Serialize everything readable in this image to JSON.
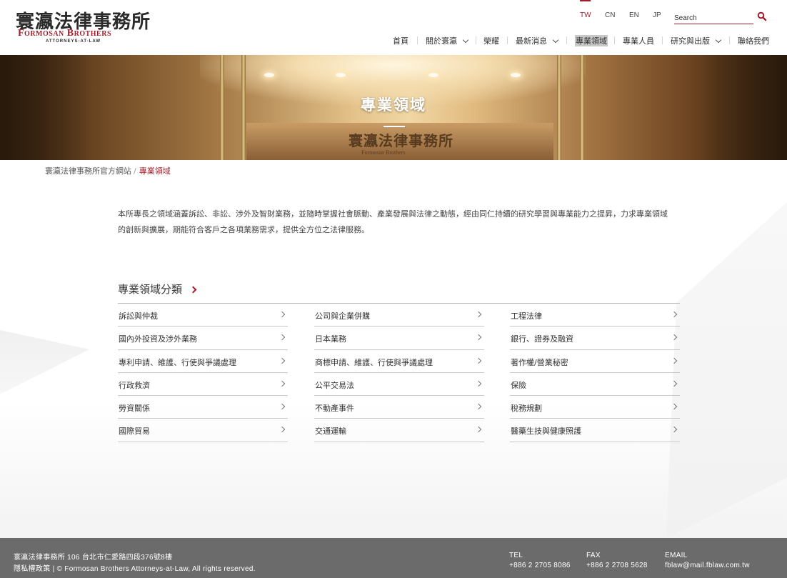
{
  "brand": {
    "name_cn": "寰瀛法律事務所",
    "name_en": "Formosan Brothers",
    "subtitle": "ATTORNEYS-AT-LAW"
  },
  "languages": [
    {
      "label": "TW",
      "active": true
    },
    {
      "label": "CN",
      "active": false
    },
    {
      "label": "EN",
      "active": false
    },
    {
      "label": "JP",
      "active": false
    }
  ],
  "search": {
    "placeholder": "Search",
    "value": ""
  },
  "nav": [
    {
      "label": "首頁",
      "dropdown": false,
      "active": false
    },
    {
      "label": "關於寰瀛",
      "dropdown": true,
      "active": false
    },
    {
      "label": "榮耀",
      "dropdown": false,
      "active": false
    },
    {
      "label": "最新消息",
      "dropdown": true,
      "active": false
    },
    {
      "label": "專業領域",
      "dropdown": false,
      "active": true
    },
    {
      "label": "專業人員",
      "dropdown": false,
      "active": false
    },
    {
      "label": "研究與出版",
      "dropdown": true,
      "active": false
    },
    {
      "label": "聯絡我們",
      "dropdown": false,
      "active": false
    }
  ],
  "banner": {
    "title": "專業領域",
    "sign_cn": "寰瀛法律事務所",
    "sign_en": "Formosan Brothers"
  },
  "breadcrumb": {
    "home": "寰瀛法律事務所官方網站",
    "separator": "/",
    "current": "專業領域"
  },
  "intro": "本所專長之領域涵蓋訴訟、非訟、涉外及智財業務，並隨時掌握社會脈動、產業發展與法律之動態，經由同仁持續的研究學習與專業能力之提昇，力求專業領域的創新與擴展，期能符合客戶之各項業務需求，提供全方位之法律服務。",
  "category": {
    "heading": "專業領域分類",
    "columns": [
      [
        "訴訟與仲裁",
        "國內外投資及涉外業務",
        "專利申請、維護、行使與爭議處理",
        "行政救濟",
        "勞資關係",
        "國際貿易"
      ],
      [
        "公司與企業併購",
        "日本業務",
        "商標申請、維護、行使與爭議處理",
        "公平交易法",
        "不動產事件",
        "交通運輸"
      ],
      [
        "工程法律",
        "銀行、證券及融資",
        "著作權/營業秘密",
        "保險",
        "稅務規劃",
        "醫藥生技與健康照護"
      ]
    ]
  },
  "footer": {
    "address": "寰瀛法律事務所 106 台北市仁愛路四段376號8樓",
    "privacy": "隱私權政策",
    "copyright": "© Formosan Brothers Attorneys-at-Law, All rights reserved.",
    "tel_label": "TEL",
    "tel": "+886 2 2705 8086",
    "fax_label": "FAX",
    "fax": "+886 2 2708 5628",
    "email_label": "EMAIL",
    "email": "fblaw@mail.fblaw.com.tw"
  },
  "colors": {
    "accent": "#a31e2a",
    "footer_bg": "#6b6b6b",
    "active_nav_bg": "#c8c8c8"
  },
  "icons": {
    "search": "search-icon",
    "dropdown": "chevron-down-icon",
    "item": "chevron-right-icon",
    "heading": "chevron-right-icon"
  }
}
